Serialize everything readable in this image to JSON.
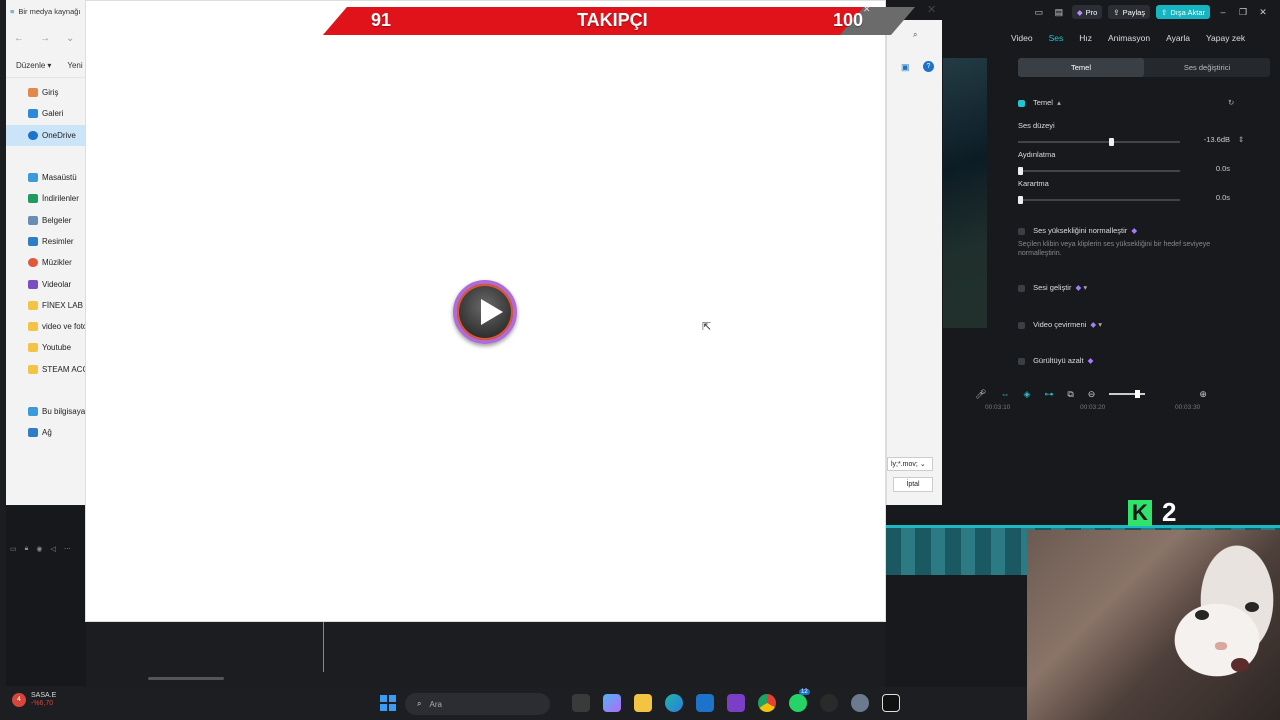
{
  "explorer": {
    "title": "Bir medya kaynağı",
    "toolbar": {
      "organize": "Düzenle",
      "new": "Yeni"
    },
    "quick": [
      {
        "label": "Giriş"
      },
      {
        "label": "Galeri"
      },
      {
        "label": "OneDrive"
      }
    ],
    "folders": [
      {
        "label": "Masaüstü"
      },
      {
        "label": "İndirilenler"
      },
      {
        "label": "Belgeler"
      },
      {
        "label": "Resimler"
      },
      {
        "label": "Müzikler"
      },
      {
        "label": "Videolar"
      },
      {
        "label": "FİNEX LAB"
      },
      {
        "label": "video ve foto"
      },
      {
        "label": "Youtube"
      },
      {
        "label": "STEAM ACC"
      }
    ],
    "bottom": [
      {
        "label": "Bu bilgisayar"
      },
      {
        "label": "Ağ"
      }
    ]
  },
  "overlay": {
    "current": "91",
    "label": "TAKIPÇI",
    "target": "100",
    "progress_fraction": 0.91,
    "colors": {
      "bar": "#e0121a",
      "dark": "#6b6b6b"
    }
  },
  "dialog": {
    "filter_value": "ly;*.mov;",
    "cancel": "İptal"
  },
  "editor": {
    "top": {
      "pro": "Pro",
      "share": "Paylaş",
      "export": "Dışa Aktar"
    },
    "tabs": [
      "Video",
      "Ses",
      "Hız",
      "Animasyon",
      "Ayarla",
      "Yapay zek"
    ],
    "active_tab": "Ses",
    "subtabs": [
      "Temel",
      "Ses değiştirici"
    ],
    "basic": {
      "section": "Temel",
      "volume_label": "Ses düzeyi",
      "volume_value": "-13.6dB",
      "fadein_label": "Aydınlatma",
      "fadein_value": "0.0s",
      "fadeout_label": "Karartma",
      "fadeout_value": "0.0s",
      "normalize_label": "Ses yüksekliğini normalleştir",
      "normalize_desc": "Seçilen klibin veya kliplerin ses yüksekliğini bir hedef seviyeye normalleştirin.",
      "enhance_label": "Sesi geliştir",
      "translate_label": "Video çevirmeni",
      "denoise_label": "Gürültüyü azalt"
    },
    "ruler": [
      "00:03:10",
      "00:03:20",
      "00:03:30"
    ]
  },
  "stream": {
    "badge_letter": "K",
    "badge_count": "2"
  },
  "taskbar": {
    "stock_name": "SASA.E",
    "stock_change": "-%6,70",
    "notif_count": "4",
    "search_placeholder": "Ara",
    "whatsapp_badge": "12"
  }
}
